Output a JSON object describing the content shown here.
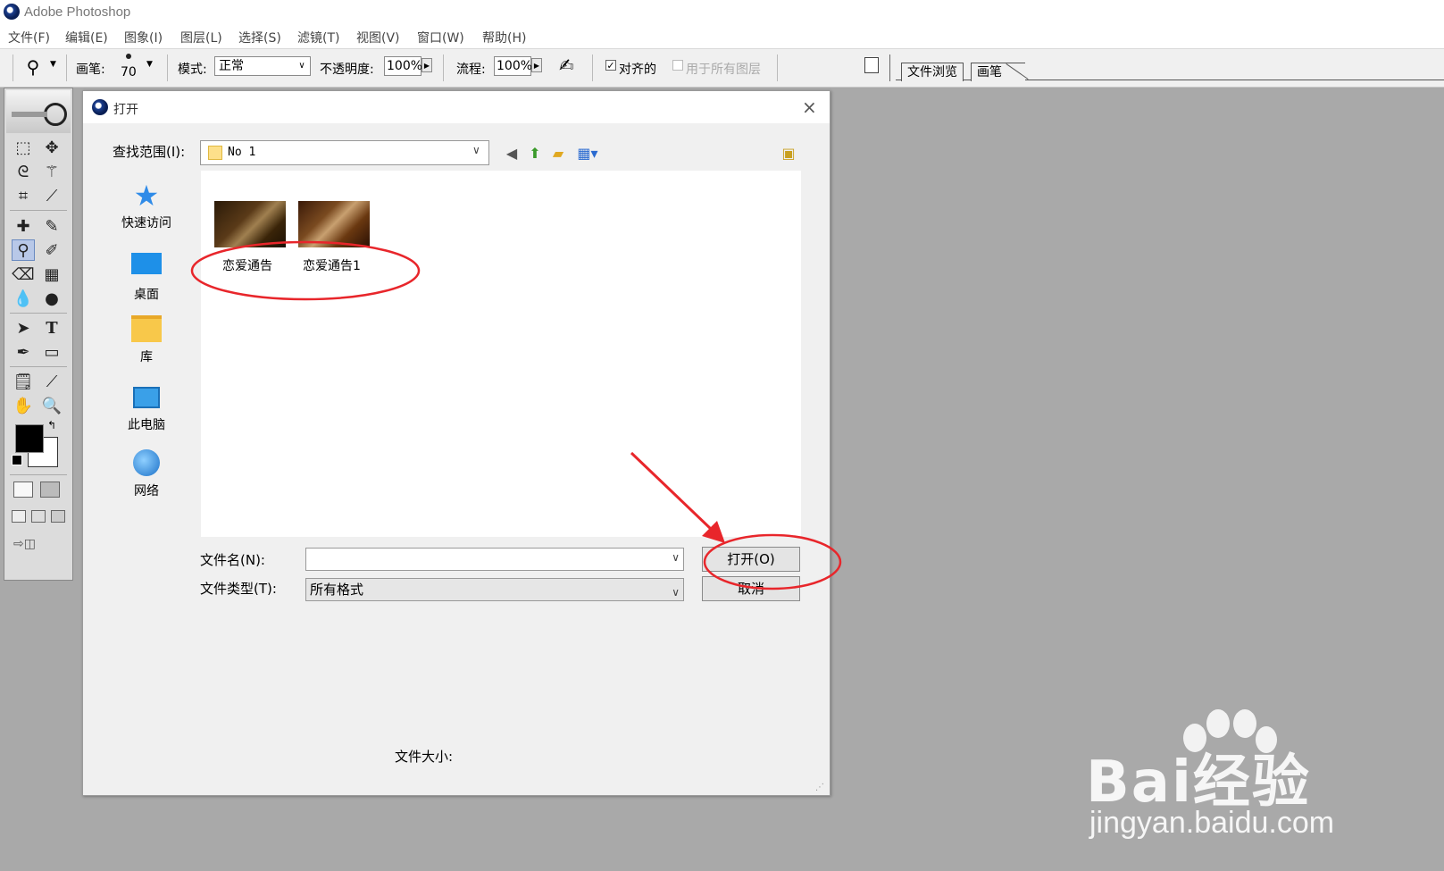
{
  "app": {
    "title": "Adobe Photoshop"
  },
  "menu": [
    "文件(F)",
    "编辑(E)",
    "图象(I)",
    "图层(L)",
    "选择(S)",
    "滤镜(T)",
    "视图(V)",
    "窗口(W)",
    "帮助(H)"
  ],
  "options": {
    "brush_label": "画笔:",
    "brush_size": "70",
    "mode_label": "模式:",
    "mode_value": "正常",
    "opacity_label": "不透明度:",
    "opacity_value": "100%",
    "flow_label": "流程:",
    "flow_value": "100%",
    "aligned_label": "对齐的",
    "aligned_checked": true,
    "all_layers_label": "用于所有图层",
    "all_layers_checked": false
  },
  "palette_tabs": [
    "文件浏览",
    "画笔"
  ],
  "dialog": {
    "title": "打开",
    "look_in_label": "查找范围(I):",
    "look_in_value": "No 1",
    "places": [
      {
        "name": "快速访问",
        "icon": "star-icon"
      },
      {
        "name": "桌面",
        "icon": "desktop-icon"
      },
      {
        "name": "库",
        "icon": "library-icon"
      },
      {
        "name": "此电脑",
        "icon": "computer-icon"
      },
      {
        "name": "网络",
        "icon": "network-icon"
      }
    ],
    "files": [
      {
        "name": "恋爱通告"
      },
      {
        "name": "恋爱通告1"
      }
    ],
    "filename_label": "文件名(N):",
    "filename_value": "",
    "filetype_label": "文件类型(T):",
    "filetype_value": "所有格式",
    "open_button": "打开(O)",
    "cancel_button": "取消",
    "filesize_label": "文件大小:"
  },
  "watermark": {
    "brand": "Bai经验",
    "url": "jingyan.baidu.com"
  },
  "annotation_color": "#e8262b"
}
